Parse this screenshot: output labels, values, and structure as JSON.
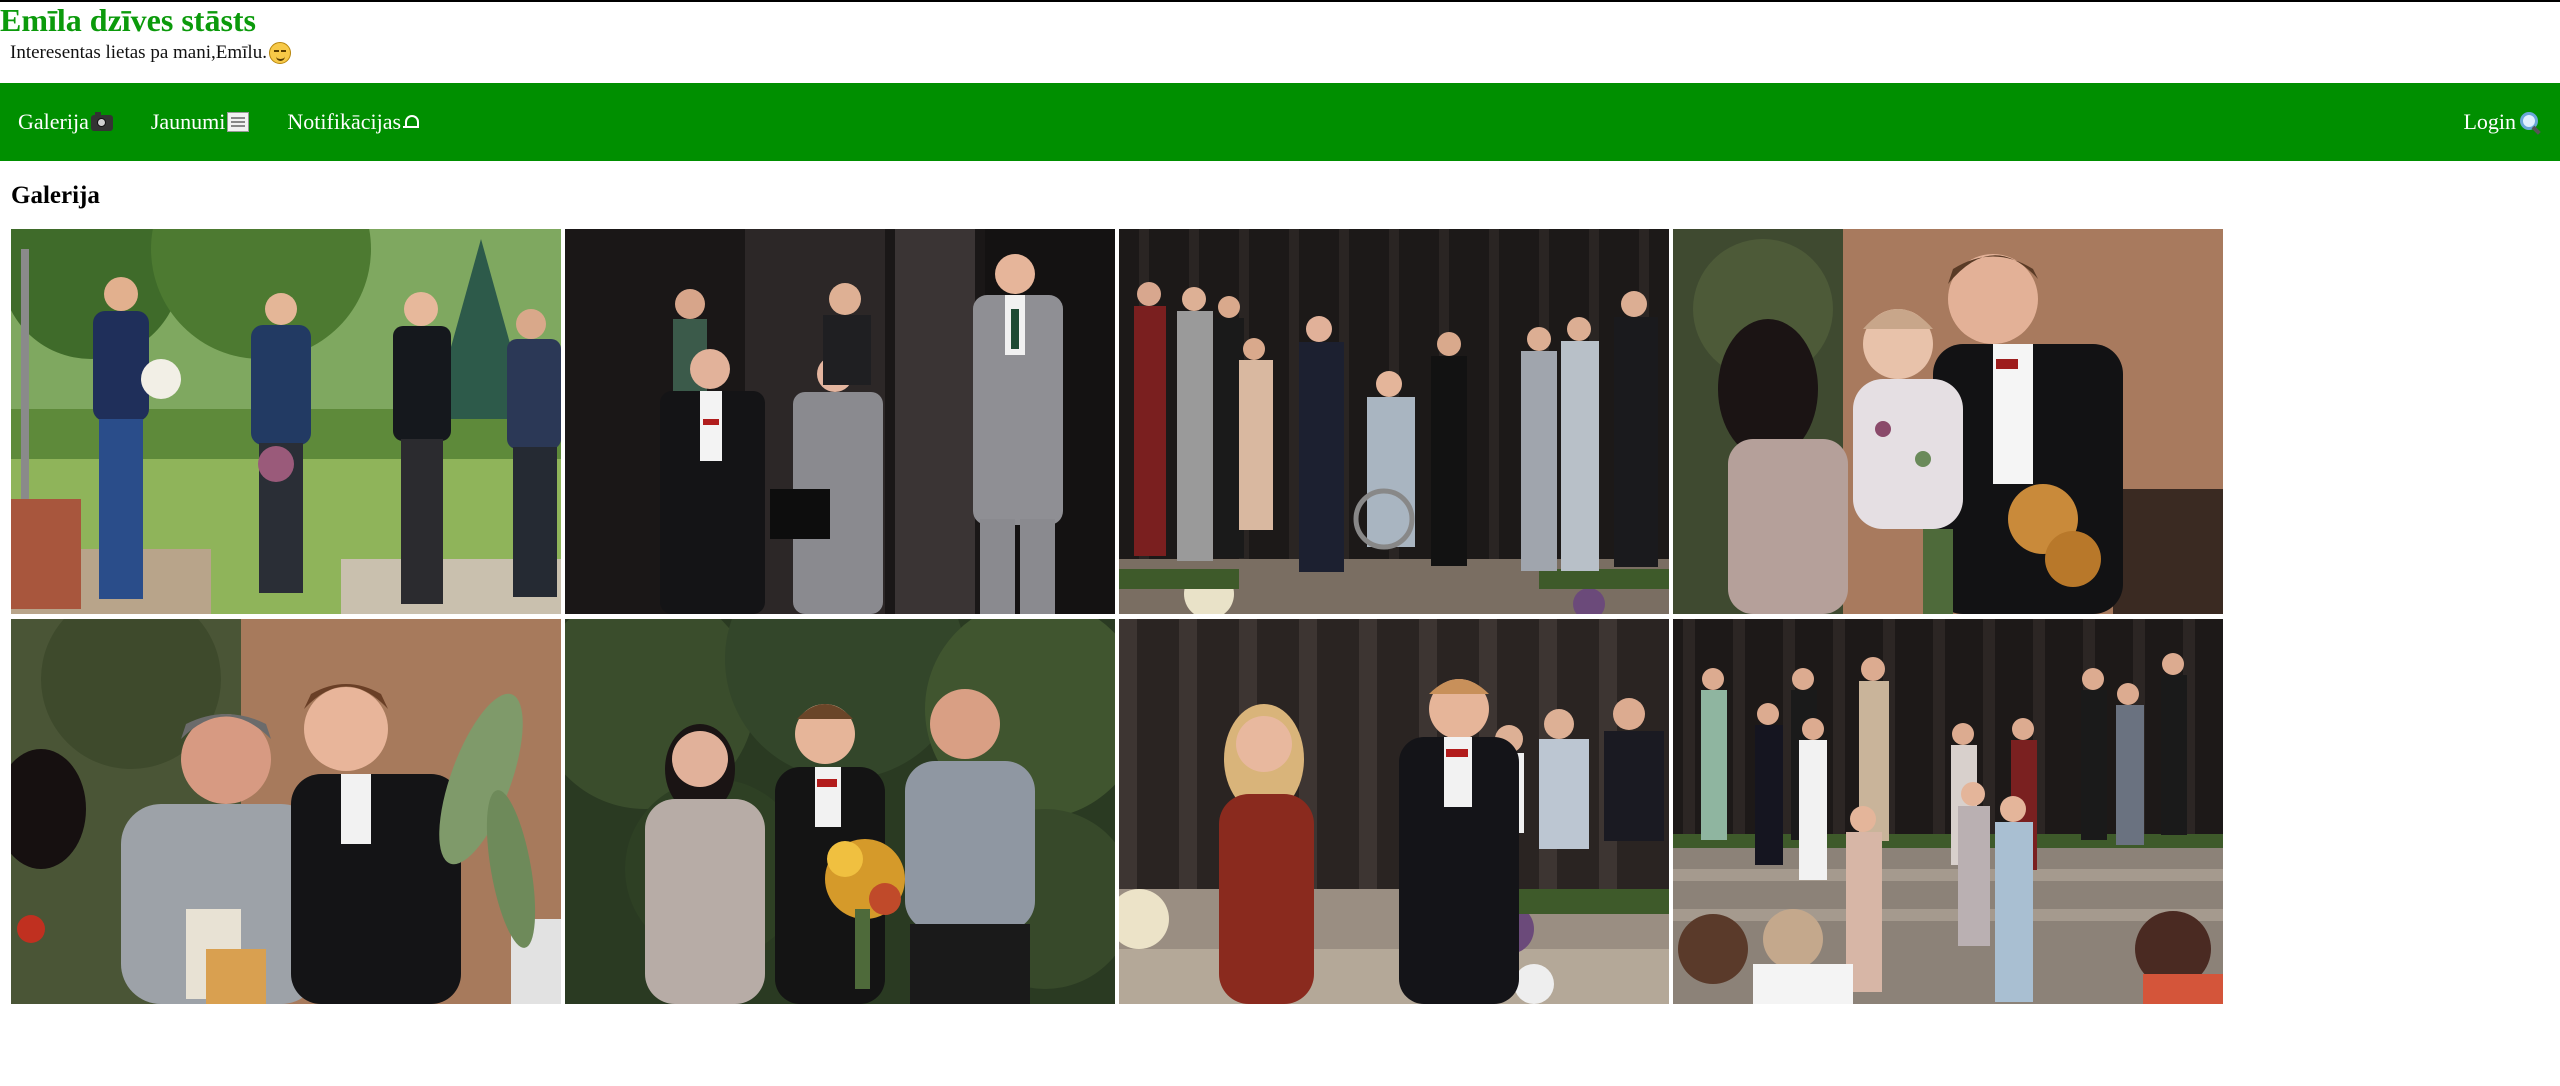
{
  "header": {
    "title": "Emīla dzīves stāsts",
    "subtitle": "Interesentas lietas pa mani,Emīlu.",
    "subtitle_icon": "smiling-face-icon"
  },
  "nav": {
    "items": [
      {
        "label": "Galerija",
        "icon": "camera-icon"
      },
      {
        "label": "Jaunumi",
        "icon": "newspaper-icon"
      },
      {
        "label": "Notifikācijas",
        "icon": "bell-icon"
      }
    ],
    "login": {
      "label": "Login",
      "icon": "search-icon"
    }
  },
  "gallery": {
    "title": "Galerija",
    "photos": [
      {
        "scene": "park"
      },
      {
        "scene": "stage-dark"
      },
      {
        "scene": "stage-group"
      },
      {
        "scene": "indoor-family"
      },
      {
        "scene": "indoor-hug"
      },
      {
        "scene": "garden-portrait"
      },
      {
        "scene": "stage-dance"
      },
      {
        "scene": "stage-audience"
      }
    ]
  },
  "colors": {
    "brand_green": "#008f00",
    "title_green": "#0b9a0b",
    "nav_text": "#ffffff"
  }
}
